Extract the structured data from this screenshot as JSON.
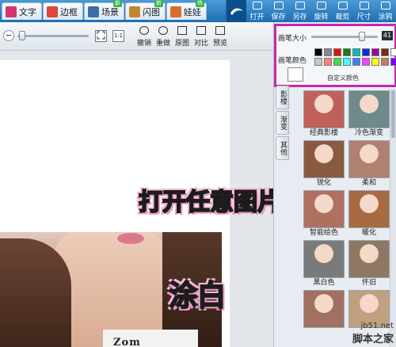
{
  "tabs": [
    {
      "label": "文字",
      "icon": "text-icon",
      "color": "#d7336f",
      "badge": ""
    },
    {
      "label": "边框",
      "icon": "frame-icon",
      "color": "#e0443d",
      "badge": ""
    },
    {
      "label": "场景",
      "icon": "scene-icon",
      "color": "#3b6fa6",
      "badge": "新"
    },
    {
      "label": "闪图",
      "icon": "flash-icon",
      "color": "#c2872c",
      "badge": "新"
    },
    {
      "label": "娃娃",
      "icon": "doll-icon",
      "color": "#d96b2b",
      "badge": "热"
    }
  ],
  "toolbar": [
    {
      "label": "打开",
      "icon": "open-icon"
    },
    {
      "label": "保存",
      "icon": "save-icon"
    },
    {
      "label": "另存",
      "icon": "save-as-icon"
    },
    {
      "label": "旋转",
      "icon": "rotate-icon"
    },
    {
      "label": "裁剪",
      "icon": "crop-icon"
    },
    {
      "label": "尺寸",
      "icon": "resize-icon"
    },
    {
      "label": "涂鸦",
      "icon": "doodle-icon"
    }
  ],
  "edit_toolbar": {
    "zoom_out": "−",
    "fit_label": "",
    "actual_label": "1:1",
    "buttons": [
      {
        "label": "撤销",
        "icon": "undo-icon"
      },
      {
        "label": "重做",
        "icon": "redo-icon"
      },
      {
        "label": "原图",
        "icon": "original-icon"
      },
      {
        "label": "对比",
        "icon": "compare-icon"
      },
      {
        "label": "预览",
        "icon": "preview-icon"
      }
    ]
  },
  "pen_panel": {
    "size_label": "画笔大小",
    "size_value": "41",
    "color_label": "画笔颜色",
    "custom_label": "自定义颜色",
    "palette": [
      "#000000",
      "#888888",
      "#e01010",
      "#1a7a1a",
      "#00c0c0",
      "#0a2ae0",
      "#a000a0",
      "#7a2a10",
      "#ffffff",
      "#c8c8c8",
      "#ff8080",
      "#40e040",
      "#40ffff",
      "#4080ff",
      "#ff40ff",
      "#ffff00",
      "#c08060",
      "#8000ff"
    ]
  },
  "side_tabs": [
    "影楼",
    "渐变",
    "其他"
  ],
  "effects": [
    {
      "label": "经典影楼",
      "color": "#c0605a"
    },
    {
      "label": "冷色渐变",
      "color": "#6f8a8a"
    },
    {
      "label": "锐化",
      "color": "#8a5a40"
    },
    {
      "label": "柔和",
      "color": "#b08070"
    },
    {
      "label": "智能绘色",
      "color": "#b07060"
    },
    {
      "label": "暖化",
      "color": "#a86a40"
    },
    {
      "label": "黑白色",
      "color": "#7a7a7a"
    },
    {
      "label": "怀旧",
      "color": "#8e7862"
    },
    {
      "label": "",
      "color": "#a07060"
    },
    {
      "label": "",
      "color": "#c0a080"
    }
  ],
  "overlay_text": {
    "line1": "打开任意图片",
    "line2": "涂白"
  },
  "photo_shirt_text": "Zom",
  "watermark": {
    "line1": "jb51.net",
    "line2": "脚本之家"
  }
}
